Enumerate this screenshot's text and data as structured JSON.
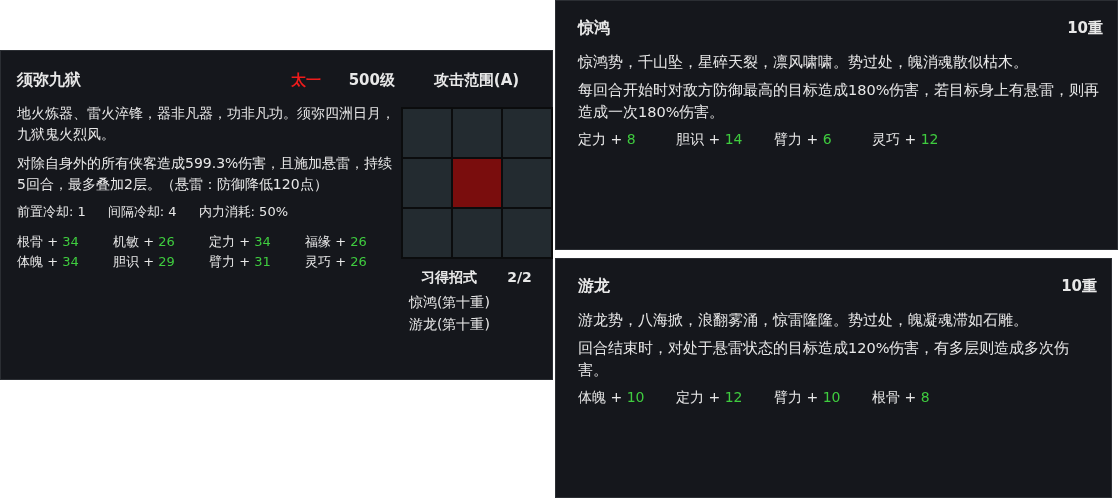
{
  "skill_panel": {
    "title": "须弥九狱",
    "school": "太一",
    "level": "500级",
    "range_title": "攻击范围(A)",
    "description": [
      "地火炼器、雷火淬锋，器非凡器，功非凡功。须弥四洲日月，九狱鬼火烈风。",
      "对除自身外的所有侠客造成599.3%伤害，且施加悬雷，持续5回合，最多叠加2层。（悬雷：防御降低120点）"
    ],
    "cooldowns": [
      {
        "label": "前置冷却:",
        "value": "1"
      },
      {
        "label": "间隔冷却:",
        "value": "4"
      },
      {
        "label": "内力消耗:",
        "value": "50%"
      }
    ],
    "stats": [
      {
        "name": "根骨 +",
        "value": "34"
      },
      {
        "name": "机敏 +",
        "value": "26"
      },
      {
        "name": "定力 +",
        "value": "34"
      },
      {
        "name": "福缘 +",
        "value": "26"
      },
      {
        "name": "体魄 +",
        "value": "34"
      },
      {
        "name": "胆识 +",
        "value": "29"
      },
      {
        "name": "臂力 +",
        "value": "31"
      },
      {
        "name": "灵巧 +",
        "value": "26"
      }
    ],
    "range_grid": [
      {
        "selected": false
      },
      {
        "selected": false
      },
      {
        "selected": false
      },
      {
        "selected": false
      },
      {
        "selected": true
      },
      {
        "selected": false
      },
      {
        "selected": false
      },
      {
        "selected": false
      },
      {
        "selected": false
      }
    ],
    "moves_title": "习得招式",
    "moves_count": "2/2",
    "moves": [
      "惊鸿(第十重)",
      "游龙(第十重)"
    ]
  },
  "move_panels": [
    {
      "title": "惊鸿",
      "rank": "10重",
      "description": [
        "惊鸿势，千山坠，星碎天裂，凛风啸啸。势过处，魄消魂散似枯木。",
        "每回合开始时对敌方防御最高的目标造成180%伤害，若目标身上有悬雷，则再造成一次180%伤害。"
      ],
      "stats": [
        {
          "name": "定力 +",
          "value": "8"
        },
        {
          "name": "胆识 +",
          "value": "14"
        },
        {
          "name": "臂力 +",
          "value": "6"
        },
        {
          "name": "灵巧 +",
          "value": "12"
        }
      ]
    },
    {
      "title": "游龙",
      "rank": "10重",
      "description": [
        "游龙势，八海掀，浪翻雾涌，惊雷隆隆。势过处，魄凝魂滞如石雕。",
        "回合结束时，对处于悬雷状态的目标造成120%伤害，有多层则造成多次伤害。"
      ],
      "stats": [
        {
          "name": "体魄 +",
          "value": "10"
        },
        {
          "name": "定力 +",
          "value": "12"
        },
        {
          "name": "臂力 +",
          "value": "10"
        },
        {
          "name": "根骨 +",
          "value": "8"
        }
      ]
    }
  ]
}
